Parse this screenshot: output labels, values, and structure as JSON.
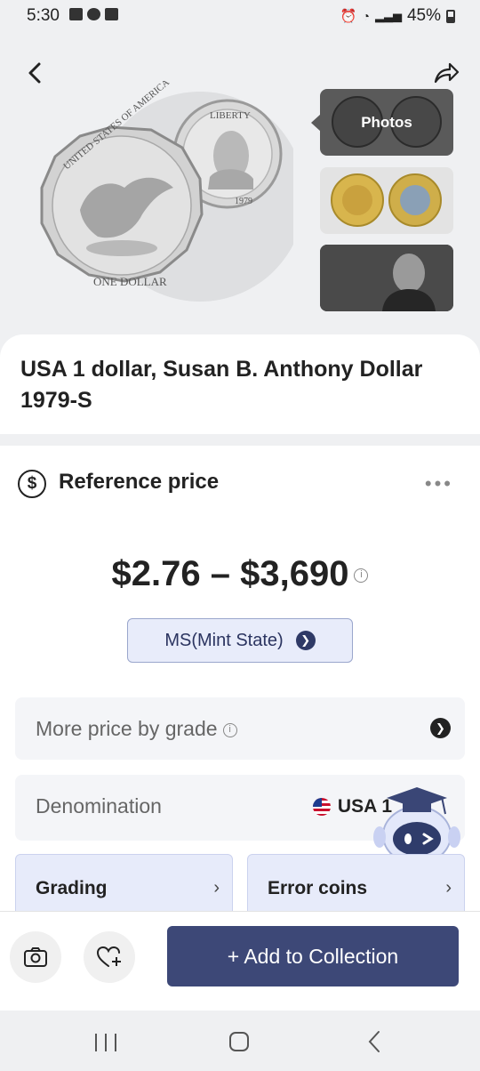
{
  "status": {
    "time": "5:30",
    "battery": "45%"
  },
  "hero": {
    "photos_label": "Photos",
    "coin_back_text": "UNITED STATES OF AMERICA",
    "coin_back_bottom": "ONE DOLLAR",
    "coin_front_text": "LIBERTY",
    "coin_front_year": "1979"
  },
  "coin": {
    "title": "USA 1 dollar, Susan B. Anthony Dollar 1979-S"
  },
  "price": {
    "section_title": "Reference price",
    "range": "$2.76 – $3,690",
    "grade": "MS(Mint State)"
  },
  "rows": {
    "more_price_label": "More price by grade",
    "denomination_label": "Denomination",
    "denomination_value": "USA 1"
  },
  "cards": {
    "grading": "Grading",
    "errors": "Error coins"
  },
  "actions": {
    "add_label": "+ Add to Collection"
  },
  "colors": {
    "primary": "#3d4877",
    "pill_bg": "#e8ecfa",
    "row_bg": "#f4f5f8"
  }
}
